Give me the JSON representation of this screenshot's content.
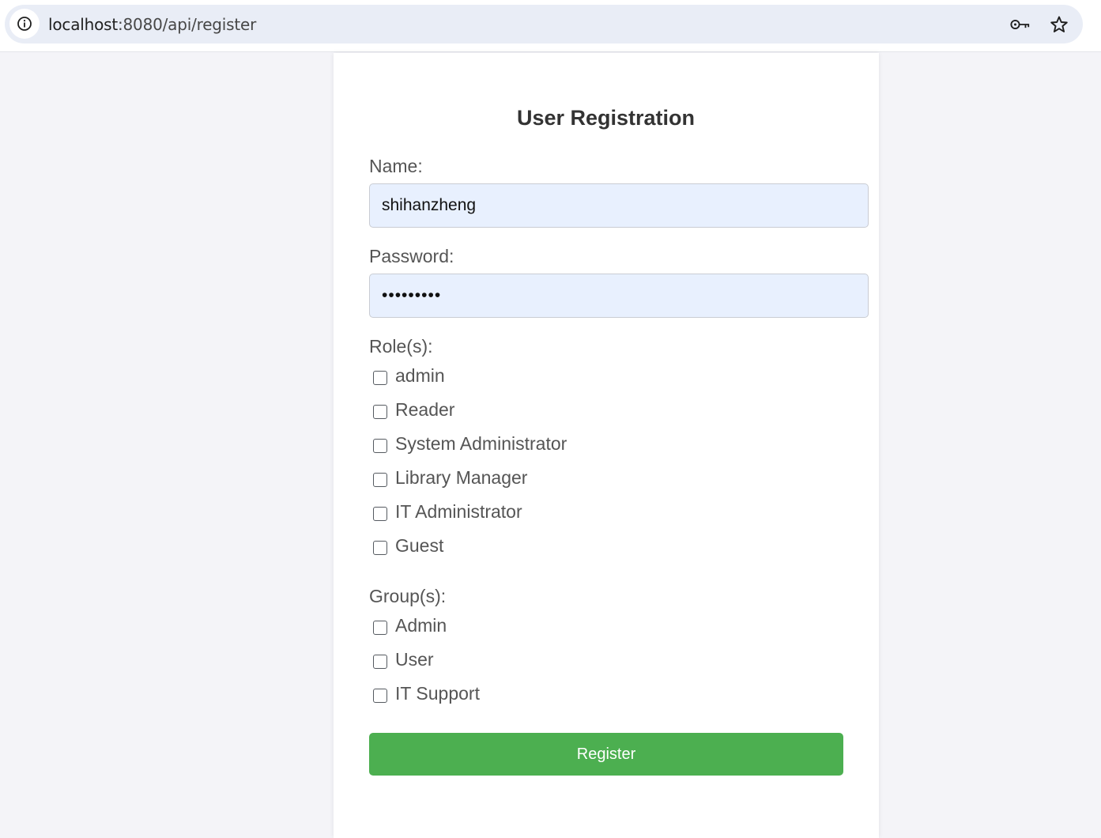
{
  "browser": {
    "url_host": "localhost",
    "url_rest": ":8080/api/register",
    "icons": [
      "site-info-icon",
      "key-icon",
      "star-icon"
    ]
  },
  "form": {
    "title": "User Registration",
    "name_label": "Name:",
    "name_value": "shihanzheng",
    "password_label": "Password:",
    "password_value": "•••••••••",
    "roles_label": "Role(s):",
    "roles": [
      {
        "label": "admin",
        "checked": false
      },
      {
        "label": "Reader",
        "checked": false
      },
      {
        "label": "System Administrator",
        "checked": false
      },
      {
        "label": "Library Manager",
        "checked": false
      },
      {
        "label": "IT Administrator",
        "checked": false
      },
      {
        "label": "Guest",
        "checked": false
      }
    ],
    "groups_label": "Group(s):",
    "groups": [
      {
        "label": "Admin",
        "checked": false
      },
      {
        "label": "User",
        "checked": false
      },
      {
        "label": "IT Support",
        "checked": false
      }
    ],
    "submit_label": "Register"
  },
  "colors": {
    "button": "#4caf50",
    "input_fill": "#e8f0fe",
    "page_bg": "#f4f4f8"
  }
}
